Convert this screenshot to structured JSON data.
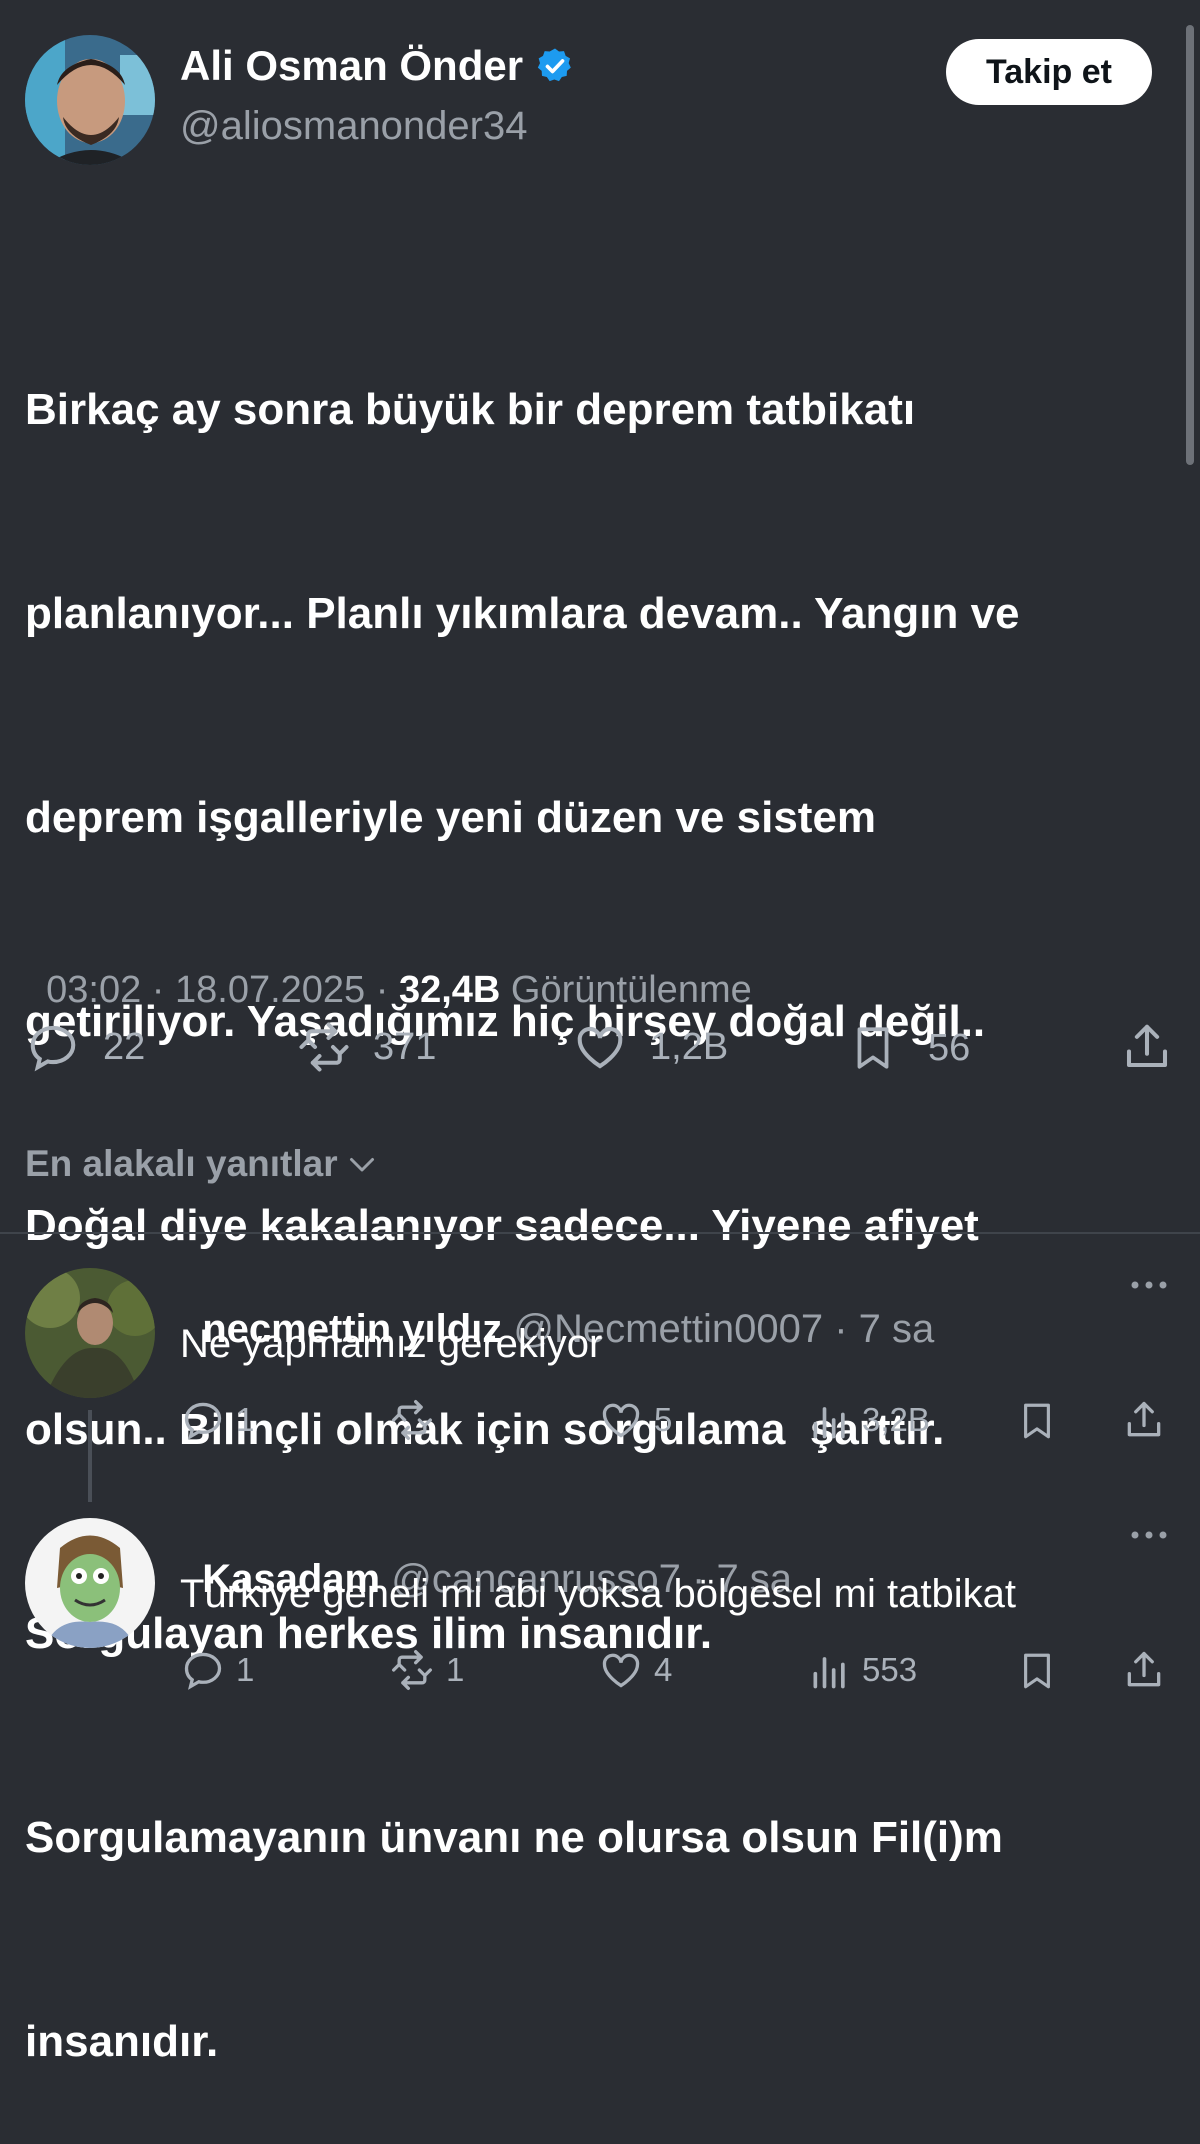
{
  "tweet": {
    "author": {
      "name": "Ali Osman Önder",
      "handle": "@aliosmanonder34",
      "verified": true,
      "follow_label": "Takip et"
    },
    "text_lines": [
      "Birkaç ay sonra büyük bir deprem tatbikatı",
      "planlanıyor... Planlı yıkımlara devam.. Yangın ve",
      "deprem işgalleriyle yeni düzen ve sistem",
      "getiriliyor. Yaşadığımız hiç birşey doğal değil..",
      "Doğal diye kakalanıyor sadece... Yiyene afiyet",
      "olsun.. Bilinçli olmak için sorgulama  şarttır.",
      "Sorgulayan herkes ilim insanıdır.",
      "Sorgulamayanın ünvanı ne olursa olsun Fil(i)m",
      "insanıdır."
    ],
    "meta": {
      "time": "03:02",
      "sep1": " · ",
      "date": "18.07.2025",
      "sep2": " · ",
      "views": "32,4B",
      "views_label": " Görüntülenme"
    },
    "stats": {
      "replies": "22",
      "reposts": "371",
      "likes": "1,2B",
      "bookmarks": "56"
    }
  },
  "replies_header": {
    "label": "En alakalı yanıtlar"
  },
  "replies": [
    {
      "name": "necmettin yıldız",
      "handle": "@Necmettin0007",
      "time": " · 7 sa",
      "text": "Ne yapmamız gerekiyor",
      "replies": "1",
      "reposts": "",
      "likes": "5",
      "views": "3,2B"
    },
    {
      "name": "Kasadam",
      "handle": "@cancanrusso7",
      "time": " · 7 sa",
      "text": "Türkiye geneli mi abi yoksa bölgesel mi tatbikat",
      "replies": "1",
      "reposts": "1",
      "likes": "4",
      "views": "553"
    }
  ],
  "colors": {
    "background": "#2a2d33",
    "verified": "#1d9bf0",
    "muted": "#9aa0a8",
    "divider": "#3f444b"
  }
}
